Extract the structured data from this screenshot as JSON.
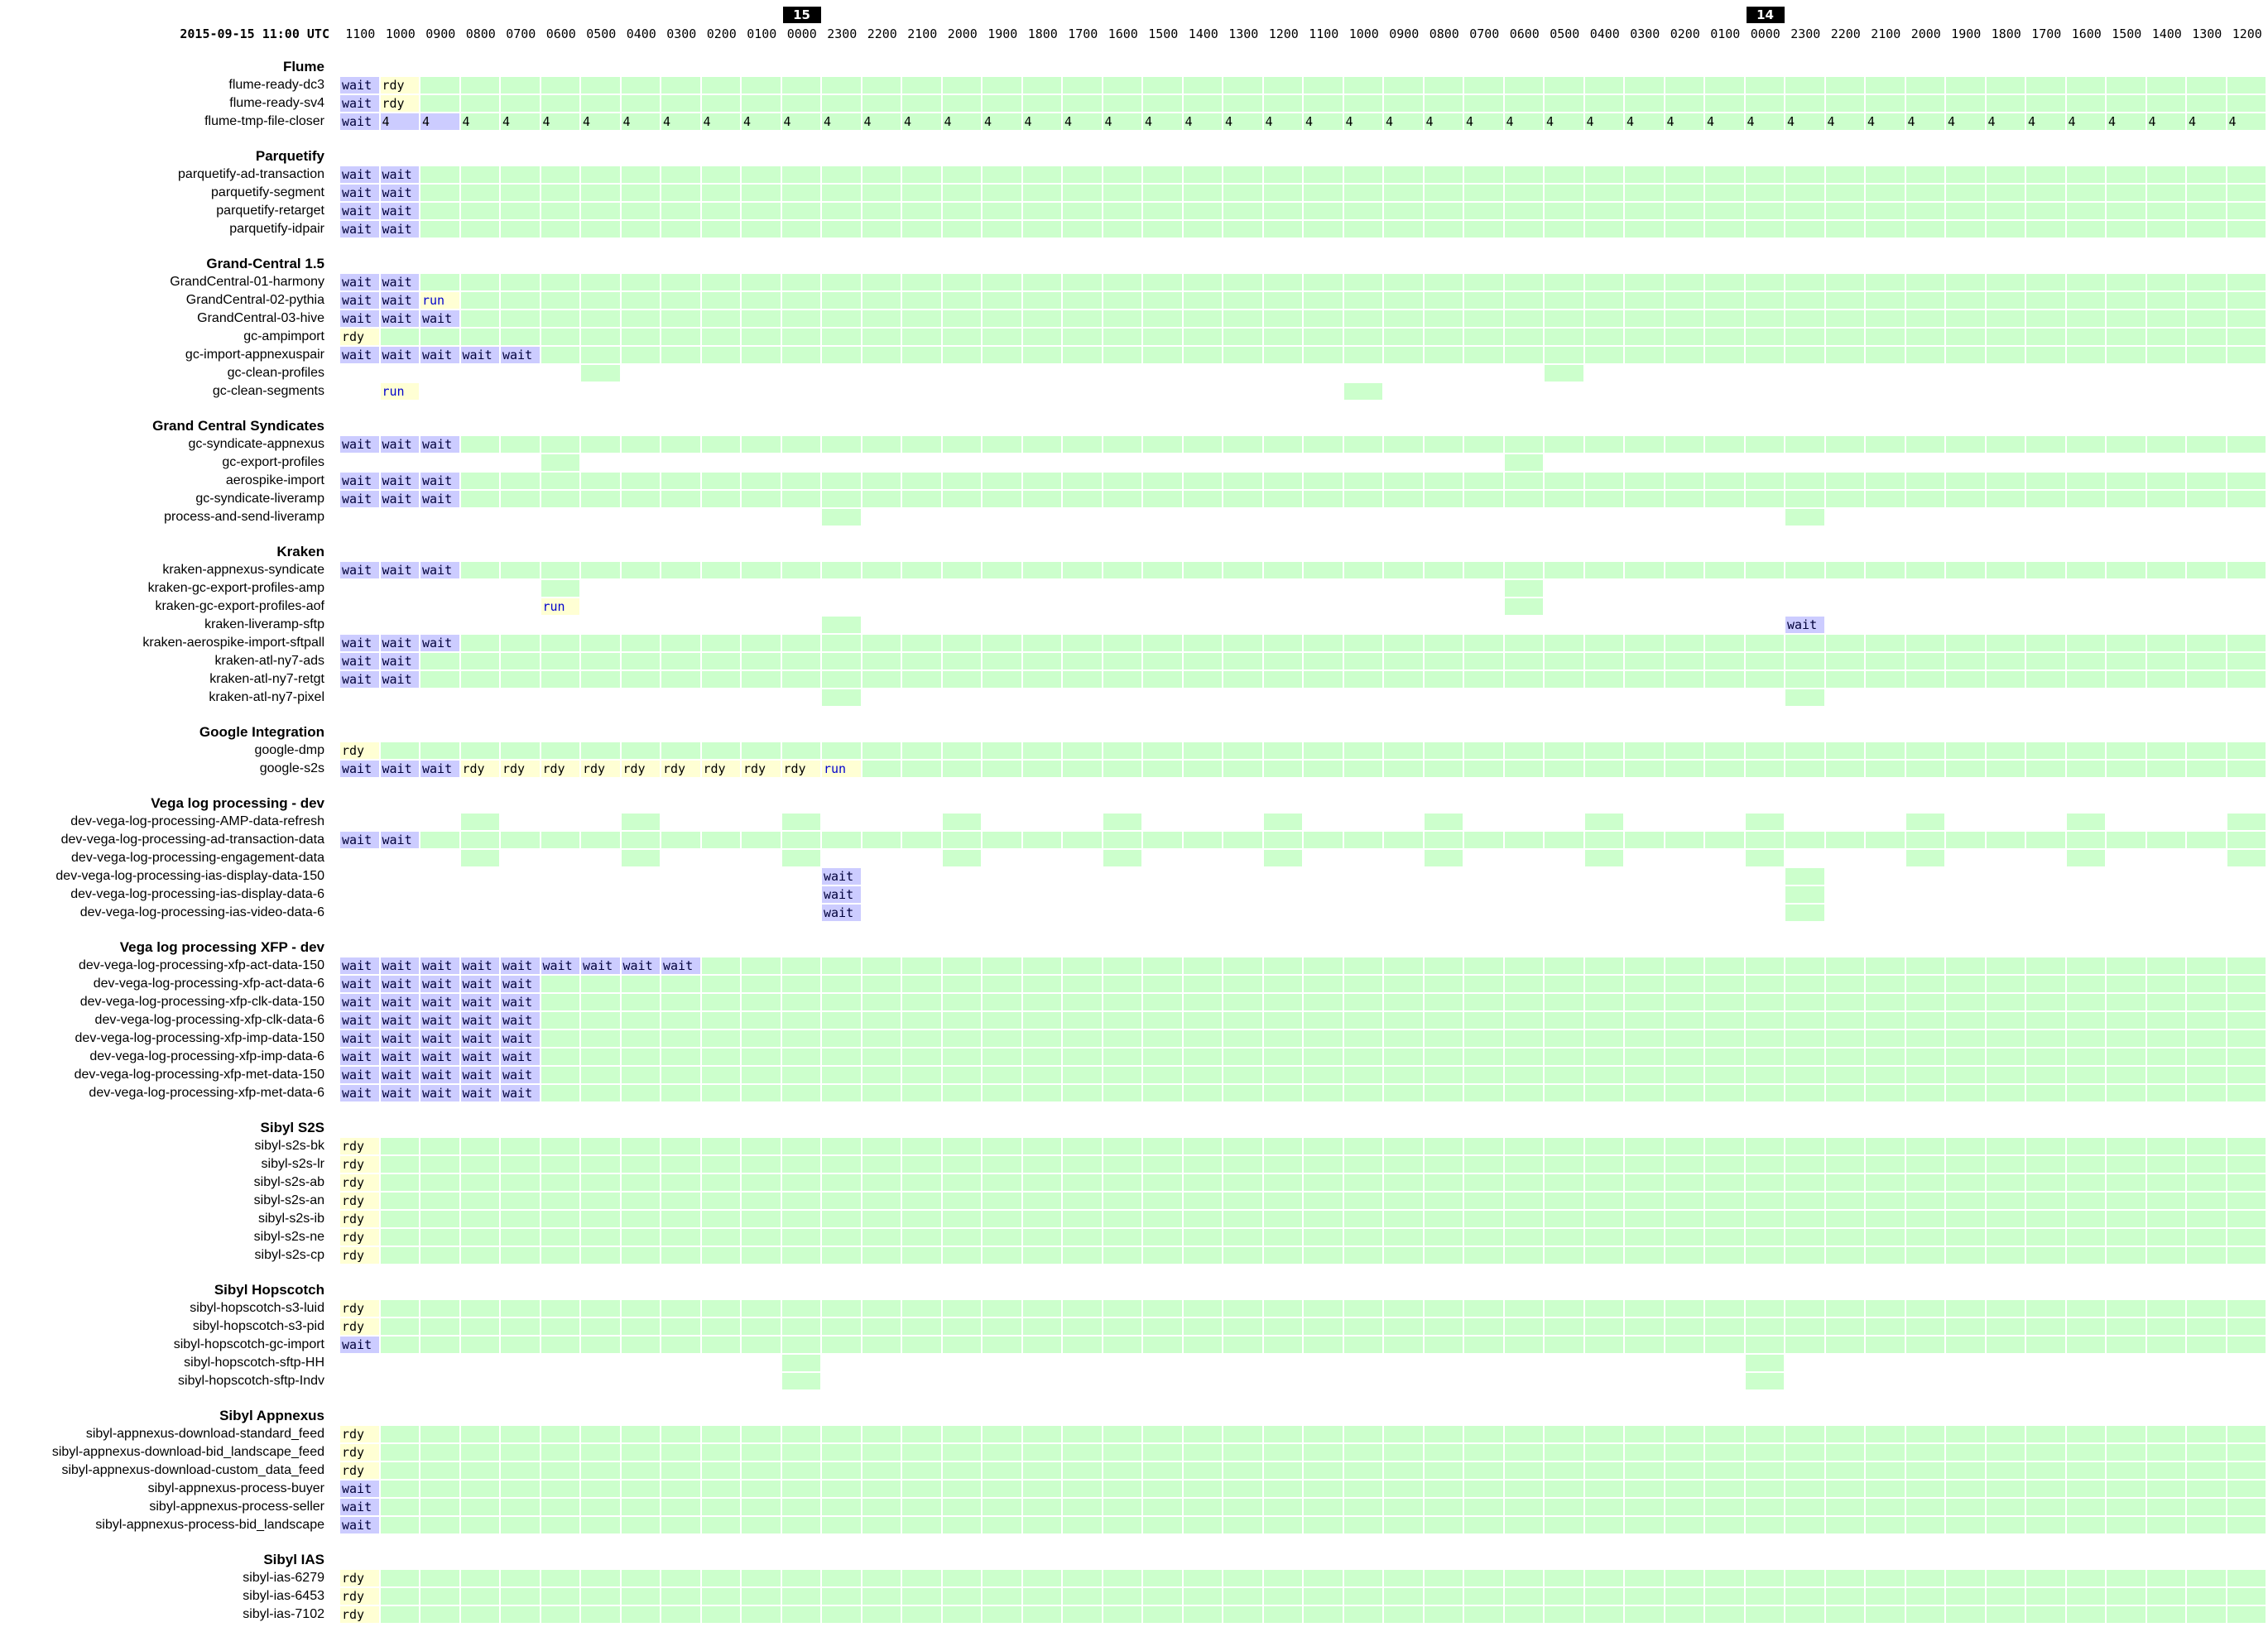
{
  "header": {
    "timestamp": "2015-09-15 11:00 UTC",
    "hours": [
      "1100",
      "1000",
      "0900",
      "0800",
      "0700",
      "0600",
      "0500",
      "0400",
      "0300",
      "0200",
      "0100",
      "0000",
      "2300",
      "2200",
      "2100",
      "2000",
      "1900",
      "1800",
      "1700",
      "1600",
      "1500",
      "1400",
      "1300",
      "1200",
      "1100",
      "1000",
      "0900",
      "0800",
      "0700",
      "0600",
      "0500",
      "0400",
      "0300",
      "0200",
      "0100",
      "0000",
      "2300",
      "2200",
      "2100",
      "2000",
      "1900",
      "1800",
      "1700",
      "1600",
      "1500",
      "1400",
      "1300",
      "1200"
    ],
    "day_markers": [
      {
        "label": "15",
        "col": 11
      },
      {
        "label": "14",
        "col": 35
      }
    ]
  },
  "colors": {
    "ok": "#ccffcc",
    "wait": "#ccccff",
    "ready": "#ffffd4",
    "run_text": "#0000cc"
  },
  "groups": [
    {
      "name": "Flume",
      "jobs": [
        {
          "name": "flume-ready-dc3",
          "cells": [
            "wait",
            "rdy"
          ],
          "fill": "all"
        },
        {
          "name": "flume-ready-sv4",
          "cells": [
            "wait",
            "rdy"
          ],
          "fill": "all"
        },
        {
          "name": "flume-tmp-file-closer",
          "cells": [
            "wait",
            "B4",
            "B4"
          ],
          "fill": "all",
          "fill_text": "4"
        }
      ]
    },
    {
      "name": "Parquetify",
      "jobs": [
        {
          "name": "parquetify-ad-transaction",
          "cells": [
            "wait",
            "wait"
          ],
          "fill": "all"
        },
        {
          "name": "parquetify-segment",
          "cells": [
            "wait",
            "wait"
          ],
          "fill": "all"
        },
        {
          "name": "parquetify-retarget",
          "cells": [
            "wait",
            "wait"
          ],
          "fill": "all"
        },
        {
          "name": "parquetify-idpair",
          "cells": [
            "wait",
            "wait"
          ],
          "fill": "all"
        }
      ]
    },
    {
      "name": "Grand-Central 1.5",
      "jobs": [
        {
          "name": "GrandCentral-01-harmony",
          "cells": [
            "wait",
            "wait"
          ],
          "fill": "all"
        },
        {
          "name": "GrandCentral-02-pythia",
          "cells": [
            "wait",
            "wait",
            "run"
          ],
          "fill": "all"
        },
        {
          "name": "GrandCentral-03-hive",
          "cells": [
            "wait",
            "wait",
            "wait"
          ],
          "fill": "all"
        },
        {
          "name": "gc-ampimport",
          "cells": [
            "rdy"
          ],
          "fill": "all"
        },
        {
          "name": "gc-import-appnexuspair",
          "cells": [
            "wait",
            "wait",
            "wait",
            "wait",
            "wait"
          ],
          "fill": "all"
        },
        {
          "name": "gc-clean-profiles",
          "cells": [],
          "fill": [
            6,
            30
          ]
        },
        {
          "name": "gc-clean-segments",
          "cells": [
            "",
            "run"
          ],
          "fill": [
            25
          ]
        }
      ]
    },
    {
      "name": "Grand Central Syndicates",
      "jobs": [
        {
          "name": "gc-syndicate-appnexus",
          "cells": [
            "wait",
            "wait",
            "wait"
          ],
          "fill": "all"
        },
        {
          "name": "gc-export-profiles",
          "cells": [],
          "fill": [
            5,
            29
          ]
        },
        {
          "name": "aerospike-import",
          "cells": [
            "wait",
            "wait",
            "wait"
          ],
          "fill": "all"
        },
        {
          "name": "gc-syndicate-liveramp",
          "cells": [
            "wait",
            "wait",
            "wait"
          ],
          "fill": "all"
        },
        {
          "name": "process-and-send-liveramp",
          "cells": [],
          "fill": [
            12,
            36
          ]
        }
      ]
    },
    {
      "name": "Kraken",
      "jobs": [
        {
          "name": "kraken-appnexus-syndicate",
          "cells": [
            "wait",
            "wait",
            "wait"
          ],
          "fill": "all"
        },
        {
          "name": "kraken-gc-export-profiles-amp",
          "cells": [],
          "fill": [
            5,
            29
          ]
        },
        {
          "name": "kraken-gc-export-profiles-aof",
          "cells": [
            "",
            "",
            "",
            "",
            "",
            "run"
          ],
          "fill": [
            29
          ]
        },
        {
          "name": "kraken-liveramp-sftp",
          "cells": [],
          "fill": [
            12
          ],
          "extra": {
            "col": 36,
            "state": "wait"
          }
        },
        {
          "name": "kraken-aerospike-import-sftpall",
          "cells": [
            "wait",
            "wait",
            "wait"
          ],
          "fill": "all"
        },
        {
          "name": "kraken-atl-ny7-ads",
          "cells": [
            "wait",
            "wait"
          ],
          "fill": "all"
        },
        {
          "name": "kraken-atl-ny7-retgt",
          "cells": [
            "wait",
            "wait"
          ],
          "fill": "all"
        },
        {
          "name": "kraken-atl-ny7-pixel",
          "cells": [],
          "fill": [
            12,
            36
          ]
        }
      ]
    },
    {
      "name": "Google Integration",
      "jobs": [
        {
          "name": "google-dmp",
          "cells": [
            "rdy"
          ],
          "fill": "all"
        },
        {
          "name": "google-s2s",
          "cells": [
            "wait",
            "wait",
            "wait",
            "rdy",
            "rdy",
            "rdy",
            "rdy",
            "rdy",
            "rdy",
            "rdy",
            "rdy",
            "rdy",
            "run"
          ],
          "fill": "all"
        }
      ]
    },
    {
      "name": "Vega log processing - dev",
      "jobs": [
        {
          "name": "dev-vega-log-processing-AMP-data-refresh",
          "cells": [],
          "fill": [
            3,
            7,
            11,
            15,
            19,
            23,
            27,
            31,
            35,
            39,
            43,
            47
          ]
        },
        {
          "name": "dev-vega-log-processing-ad-transaction-data",
          "cells": [
            "wait",
            "wait"
          ],
          "fill": "all"
        },
        {
          "name": "dev-vega-log-processing-engagement-data",
          "cells": [],
          "fill": [
            3,
            7,
            11,
            15,
            19,
            23,
            27,
            31,
            35,
            39,
            43,
            47
          ]
        },
        {
          "name": "dev-vega-log-processing-ias-display-data-150",
          "cells": [],
          "fill": [
            36
          ],
          "extra": {
            "col": 12,
            "state": "wait"
          }
        },
        {
          "name": "dev-vega-log-processing-ias-display-data-6",
          "cells": [],
          "fill": [
            36
          ],
          "extra": {
            "col": 12,
            "state": "wait"
          }
        },
        {
          "name": "dev-vega-log-processing-ias-video-data-6",
          "cells": [],
          "fill": [
            36
          ],
          "extra": {
            "col": 12,
            "state": "wait"
          }
        }
      ]
    },
    {
      "name": "Vega log processing XFP - dev",
      "jobs": [
        {
          "name": "dev-vega-log-processing-xfp-act-data-150",
          "cells": [
            "wait",
            "wait",
            "wait",
            "wait",
            "wait",
            "wait",
            "wait",
            "wait",
            "wait"
          ],
          "fill": "all"
        },
        {
          "name": "dev-vega-log-processing-xfp-act-data-6",
          "cells": [
            "wait",
            "wait",
            "wait",
            "wait",
            "wait"
          ],
          "fill": "all"
        },
        {
          "name": "dev-vega-log-processing-xfp-clk-data-150",
          "cells": [
            "wait",
            "wait",
            "wait",
            "wait",
            "wait"
          ],
          "fill": "all"
        },
        {
          "name": "dev-vega-log-processing-xfp-clk-data-6",
          "cells": [
            "wait",
            "wait",
            "wait",
            "wait",
            "wait"
          ],
          "fill": "all"
        },
        {
          "name": "dev-vega-log-processing-xfp-imp-data-150",
          "cells": [
            "wait",
            "wait",
            "wait",
            "wait",
            "wait"
          ],
          "fill": "all"
        },
        {
          "name": "dev-vega-log-processing-xfp-imp-data-6",
          "cells": [
            "wait",
            "wait",
            "wait",
            "wait",
            "wait"
          ],
          "fill": "all"
        },
        {
          "name": "dev-vega-log-processing-xfp-met-data-150",
          "cells": [
            "wait",
            "wait",
            "wait",
            "wait",
            "wait"
          ],
          "fill": "all"
        },
        {
          "name": "dev-vega-log-processing-xfp-met-data-6",
          "cells": [
            "wait",
            "wait",
            "wait",
            "wait",
            "wait"
          ],
          "fill": "all"
        }
      ]
    },
    {
      "name": "Sibyl S2S",
      "jobs": [
        {
          "name": "sibyl-s2s-bk",
          "cells": [
            "rdy"
          ],
          "fill": "all"
        },
        {
          "name": "sibyl-s2s-lr",
          "cells": [
            "rdy"
          ],
          "fill": "all"
        },
        {
          "name": "sibyl-s2s-ab",
          "cells": [
            "rdy"
          ],
          "fill": "all"
        },
        {
          "name": "sibyl-s2s-an",
          "cells": [
            "rdy"
          ],
          "fill": "all"
        },
        {
          "name": "sibyl-s2s-ib",
          "cells": [
            "rdy"
          ],
          "fill": "all"
        },
        {
          "name": "sibyl-s2s-ne",
          "cells": [
            "rdy"
          ],
          "fill": "all"
        },
        {
          "name": "sibyl-s2s-cp",
          "cells": [
            "rdy"
          ],
          "fill": "all"
        }
      ]
    },
    {
      "name": "Sibyl Hopscotch",
      "jobs": [
        {
          "name": "sibyl-hopscotch-s3-luid",
          "cells": [
            "rdy"
          ],
          "fill": "all"
        },
        {
          "name": "sibyl-hopscotch-s3-pid",
          "cells": [
            "rdy"
          ],
          "fill": "all"
        },
        {
          "name": "sibyl-hopscotch-gc-import",
          "cells": [
            "wait"
          ],
          "fill": "all"
        },
        {
          "name": "sibyl-hopscotch-sftp-HH",
          "cells": [],
          "fill": [
            11,
            35
          ]
        },
        {
          "name": "sibyl-hopscotch-sftp-Indv",
          "cells": [],
          "fill": [
            11,
            35
          ]
        }
      ]
    },
    {
      "name": "Sibyl Appnexus",
      "jobs": [
        {
          "name": "sibyl-appnexus-download-standard_feed",
          "cells": [
            "rdy"
          ],
          "fill": "all"
        },
        {
          "name": "sibyl-appnexus-download-bid_landscape_feed",
          "cells": [
            "rdy"
          ],
          "fill": "all"
        },
        {
          "name": "sibyl-appnexus-download-custom_data_feed",
          "cells": [
            "rdy"
          ],
          "fill": "all"
        },
        {
          "name": "sibyl-appnexus-process-buyer",
          "cells": [
            "wait"
          ],
          "fill": "all"
        },
        {
          "name": "sibyl-appnexus-process-seller",
          "cells": [
            "wait"
          ],
          "fill": "all"
        },
        {
          "name": "sibyl-appnexus-process-bid_landscape",
          "cells": [
            "wait"
          ],
          "fill": "all"
        }
      ]
    },
    {
      "name": "Sibyl IAS",
      "jobs": [
        {
          "name": "sibyl-ias-6279",
          "cells": [
            "rdy"
          ],
          "fill": "all"
        },
        {
          "name": "sibyl-ias-6453",
          "cells": [
            "rdy"
          ],
          "fill": "all"
        },
        {
          "name": "sibyl-ias-7102",
          "cells": [
            "rdy"
          ],
          "fill": "all"
        }
      ]
    }
  ]
}
